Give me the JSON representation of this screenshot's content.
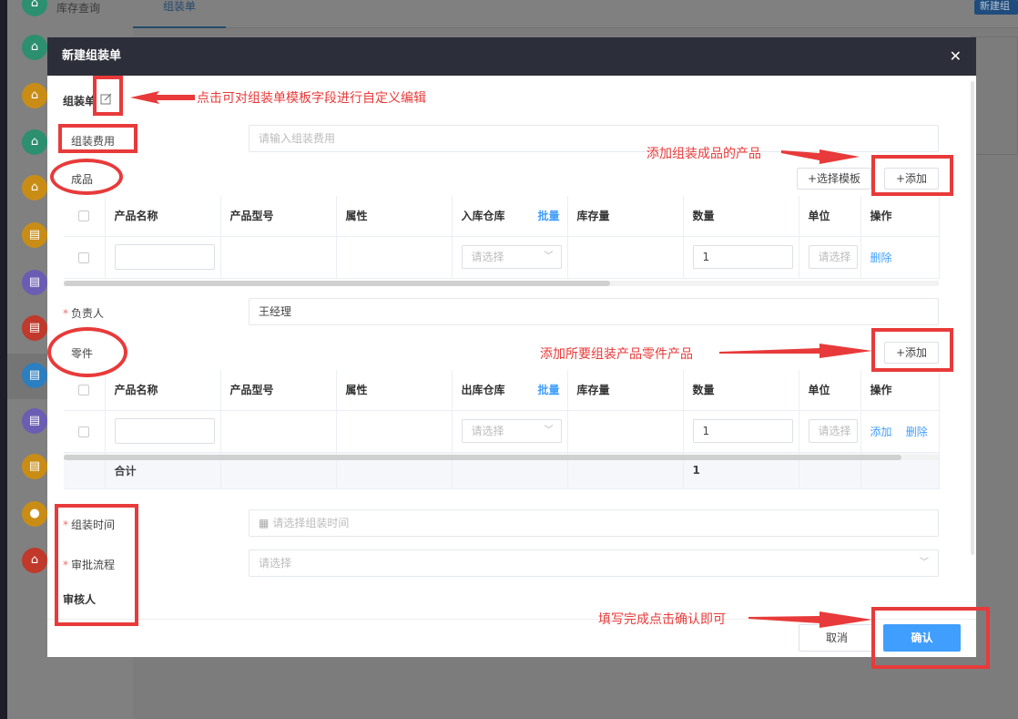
{
  "background": {
    "sidebar_top_item": "库存查询",
    "active_tab": "组装单",
    "new_button": "新建组",
    "sidebar_icon_colors": [
      "#2c8f6f",
      "#2c8f6f",
      "#c98d16",
      "#2c8f6f",
      "#c98d16",
      "#c98d16",
      "#6b5db3",
      "#c0392b",
      "#2b7fc0",
      "#6b5db3",
      "#c98d16",
      "#c98d16",
      "#c0392b"
    ]
  },
  "modal": {
    "title": "新建组装单",
    "close_icon": "close-icon",
    "section_label": "组装单",
    "edit_icon": "edit-icon",
    "fee_label": "组装费用",
    "fee_placeholder": "请输入组装费用",
    "product_section": {
      "label": "成品",
      "select_template_btn": "+选择模板",
      "add_btn": "+添加",
      "columns": [
        "产品名称",
        "产品型号",
        "属性",
        "入库仓库",
        "库存量",
        "数量",
        "单位",
        "操作"
      ],
      "batch_label": "批量",
      "row": {
        "warehouse_placeholder": "请选择",
        "quantity": "1",
        "unit_placeholder": "请选择",
        "delete": "删除"
      }
    },
    "manager": {
      "label": "负责人",
      "value": "王经理"
    },
    "parts_section": {
      "label": "零件",
      "add_btn": "+添加",
      "columns": [
        "产品名称",
        "产品型号",
        "属性",
        "出库仓库",
        "库存量",
        "数量",
        "单位",
        "操作"
      ],
      "batch_label": "批量",
      "row": {
        "warehouse_placeholder": "请选择",
        "quantity": "1",
        "unit_placeholder": "请选择",
        "add": "添加",
        "delete": "删除"
      },
      "total_label": "合计",
      "total_quantity": "1"
    },
    "assembly_time": {
      "label": "组装时间",
      "placeholder": "请选择组装时间",
      "icon": "calendar-icon"
    },
    "approval": {
      "label": "审批流程",
      "placeholder": "请选择"
    },
    "reviewer_label": "审核人",
    "cancel_btn": "取消",
    "confirm_btn": "确认"
  },
  "annotations": {
    "edit_note": "点击可对组装单模板字段进行自定义编辑",
    "add_product_note": "添加组装成品的产品",
    "add_parts_note": "添加所要组装产品零件产品",
    "confirm_note": "填写完成点击确认即可",
    "color": "#e83a3a"
  }
}
